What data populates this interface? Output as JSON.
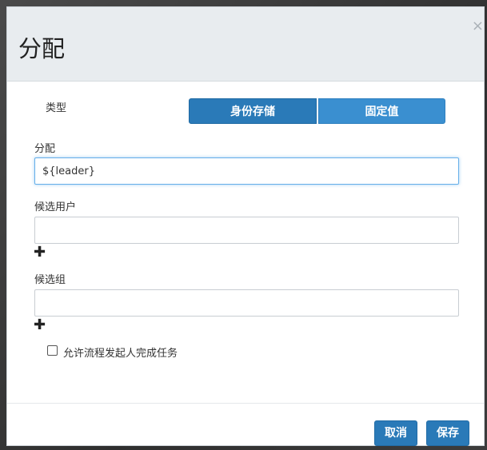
{
  "dialog": {
    "title": "分配",
    "close_glyph": "×"
  },
  "type_selector": {
    "label": "类型",
    "options": [
      "身份存储",
      "固定值"
    ],
    "selected": "身份存储"
  },
  "assignee": {
    "label": "分配",
    "value": "${leader}"
  },
  "candidate_users": {
    "label": "候选用户",
    "value": "",
    "add_glyph": "✚"
  },
  "candidate_groups": {
    "label": "候选组",
    "value": "",
    "add_glyph": "✚"
  },
  "initiator_option": {
    "label": "允许流程发起人完成任务",
    "checked": false
  },
  "footer": {
    "cancel_label": "取消",
    "save_label": "保存"
  },
  "colors": {
    "primary": "#2a7ab8",
    "primary_light": "#3a8fd0",
    "header_bg": "#e8ecef",
    "focus": "#66afe9"
  },
  "icons": {
    "close": "close-icon",
    "add": "plus-icon",
    "checkbox": "checkbox-icon"
  }
}
